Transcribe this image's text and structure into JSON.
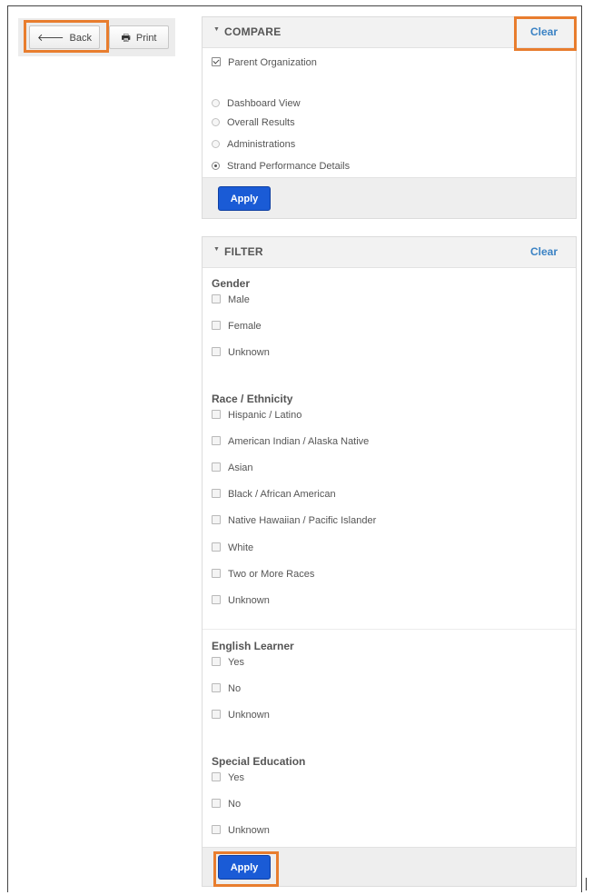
{
  "toolbar": {
    "back_label": "Back",
    "print_label": "Print",
    "back_icon": "arrow-left-icon",
    "print_icon": "printer-icon"
  },
  "compare": {
    "title": "COMPARE",
    "clear_label": "Clear",
    "checkbox": {
      "label": "Parent Organization",
      "checked": true
    },
    "options": [
      {
        "label": "Dashboard View",
        "selected": false
      },
      {
        "label": "Overall Results",
        "selected": false
      },
      {
        "label": "Administrations",
        "selected": false
      },
      {
        "label": "Strand Performance Details",
        "selected": true
      }
    ],
    "apply_label": "Apply"
  },
  "filter": {
    "title": "FILTER",
    "clear_label": "Clear",
    "groups": [
      {
        "title": "Gender",
        "items": [
          "Male",
          "Female",
          "Unknown"
        ]
      },
      {
        "title": "Race / Ethnicity",
        "items": [
          "Hispanic / Latino",
          "American Indian / Alaska Native",
          "Asian",
          "Black / African American",
          "Native Hawaiian / Pacific Islander",
          "White",
          "Two or More Races",
          "Unknown"
        ]
      },
      {
        "title": "English Learner",
        "items": [
          "Yes",
          "No",
          "Unknown"
        ]
      },
      {
        "title": "Special Education",
        "items": [
          "Yes",
          "No",
          "Unknown"
        ]
      }
    ],
    "apply_label": "Apply"
  },
  "colors": {
    "highlight": "#e87d2e",
    "apply_button": "#1a5bd6",
    "link": "#3a82c4"
  }
}
